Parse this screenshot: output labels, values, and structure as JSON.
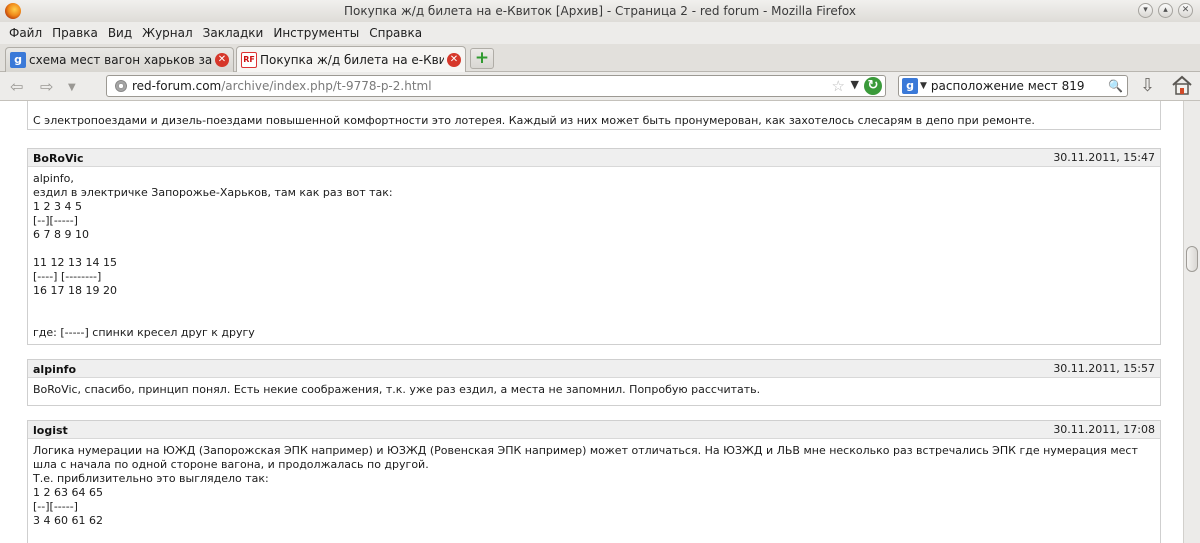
{
  "window": {
    "title": "Покупка ж/д билета на е-Квиток [Архив] - Страница 2 - red forum - Mozilla Firefox"
  },
  "menu": [
    "Файл",
    "Правка",
    "Вид",
    "Журнал",
    "Закладки",
    "Инструменты",
    "Справка"
  ],
  "tabs": [
    {
      "label": "схема мест вагон харьков запор...",
      "icon": "google-favicon",
      "active": false
    },
    {
      "label": "Покупка ж/д билета на е-Квиток ...",
      "icon": "redforum-favicon",
      "active": true
    }
  ],
  "navbar": {
    "url_host": "red-forum.com",
    "url_path": "/archive/index.php/t-9778-p-2.html",
    "search_engine": "Google",
    "search_value": "расположение мест 819"
  },
  "posts": [
    {
      "author": "",
      "date": "",
      "lines": [
        "С электропоездами и дизель-поездами повышенной комфортности это лотерея. Каждый из них может быть пронумерован, как захотелось слесарям в депо при ремонте."
      ]
    },
    {
      "author": "BoRoVic",
      "date": "30.11.2011, 15:47",
      "lines": [
        "alpinfo,",
        "ездил в электричке Запорожье-Харьков, там как раз вот так:",
        "1 2 3 4 5",
        "[--][-----]",
        "6 7 8 9 10",
        "",
        "11 12 13 14 15",
        "[----] [--------]",
        "16 17 18 19 20",
        "",
        "",
        "где: [-----] спинки кресел друг к другу"
      ]
    },
    {
      "author": "alpinfo",
      "date": "30.11.2011, 15:57",
      "lines": [
        "BoRoVic, спасибо, принцип понял. Есть некие соображения, т.к. уже раз ездил, а места не запомнил. Попробую рассчитать."
      ]
    },
    {
      "author": "logist",
      "date": "30.11.2011, 17:08",
      "lines": [
        "Логика нумерации на ЮЖД (Запорожская ЭПК например) и ЮЗЖД (Ровенская ЭПК например) может отличаться. На ЮЗЖД и ЛЬВ мне несколько раз встречались ЭПК где нумерация мест шла с начала по одной стороне вагона, и продолжалась по другой.",
        "Т.е. приблизительно это выглядело так:",
        "1 2 63 64 65",
        "[--][-----]",
        "3 4 60 61 62"
      ]
    }
  ]
}
